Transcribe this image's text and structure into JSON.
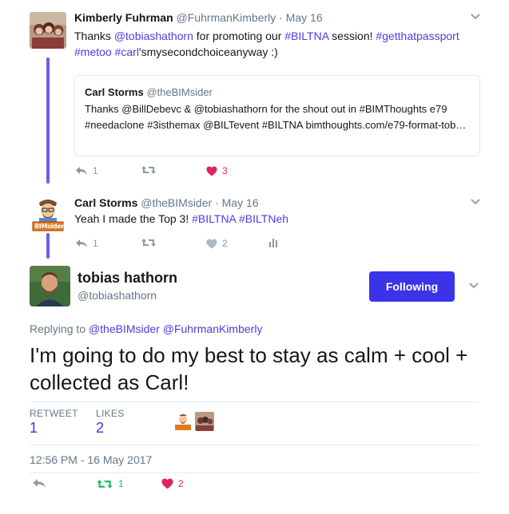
{
  "tweets": [
    {
      "name": "Kimberly Fuhrman",
      "handle": "@FuhrmanKimberly",
      "separator": "·",
      "date": "May 16",
      "text_segments": [
        {
          "text": "Thanks ",
          "link": false
        },
        {
          "text": "@tobiashathorn",
          "link": true
        },
        {
          "text": " for promoting our ",
          "link": false
        },
        {
          "text": "#BILTNA",
          "link": true
        },
        {
          "text": " session! ",
          "link": false
        },
        {
          "text": "#getthatpassport",
          "link": true
        },
        {
          "text": " ",
          "link": false
        },
        {
          "text": "#metoo",
          "link": true
        },
        {
          "text": " ",
          "link": false
        },
        {
          "text": "#carl",
          "link": true
        },
        {
          "text": "'smysecondchoiceanyway :)",
          "link": false
        }
      ],
      "quote": {
        "name": "Carl Storms",
        "handle": "@theBIMsider",
        "text": "Thanks @BillDebevc & @tobiashathorn for the shout out in #BIMThoughts e79 #needaclone #3isthemax @BILTevent #BILTNA bimthoughts.com/e79-format-tob…"
      },
      "actions": {
        "reply_count": "1",
        "retweet_count": "",
        "like_count": "3"
      }
    },
    {
      "name": "Carl Storms",
      "handle": "@theBIMsider",
      "separator": "·",
      "date": "May 16",
      "text_segments": [
        {
          "text": "Yeah I made the Top 3! ",
          "link": false
        },
        {
          "text": "#BILTNA",
          "link": true
        },
        {
          "text": " ",
          "link": false
        },
        {
          "text": "#BILTNeh",
          "link": true
        }
      ],
      "avatar_text": "BIMsider",
      "actions": {
        "reply_count": "1",
        "retweet_count": "",
        "like_count": "2"
      }
    }
  ],
  "main_tweet": {
    "name": "tobias hathorn",
    "handle": "@tobiashathorn",
    "follow_label": "Following",
    "replying_prefix": "Replying to",
    "replying_to": [
      "@theBIMsider",
      "@FuhrmanKimberly"
    ],
    "text": "I'm going to do my best to stay as calm + cool + collected as Carl!",
    "stats": {
      "retweet_label": "RETWEET",
      "retweet_value": "1",
      "likes_label": "LIKES",
      "likes_value": "2"
    },
    "timestamp": "12:56 PM - 16 May 2017",
    "actions": {
      "retweet_count": "1",
      "like_count": "2"
    }
  },
  "colors": {
    "accent": "#3a33e8",
    "link": "#4a3ee0",
    "thread_line": "#6a5cf0",
    "like": "#e0245e",
    "retweet": "#17bf63",
    "muted": "#657786"
  }
}
